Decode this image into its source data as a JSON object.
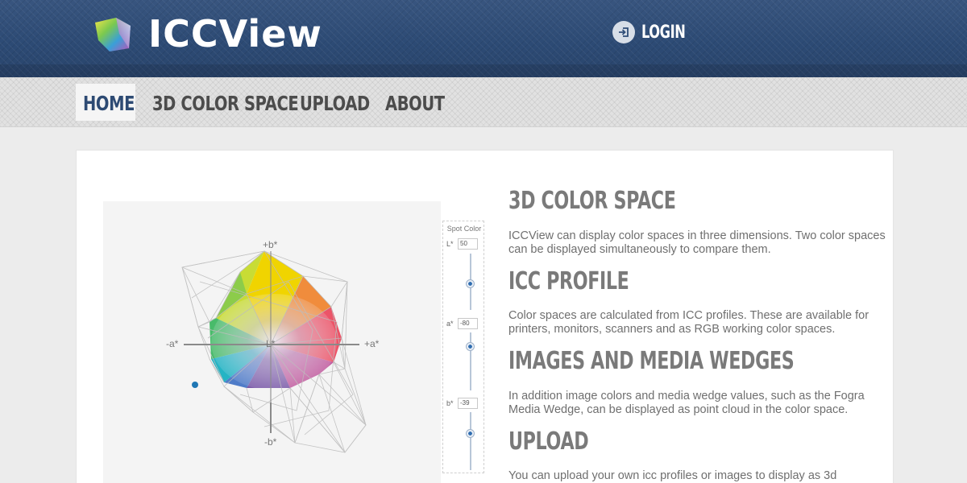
{
  "header": {
    "app_name": "ICCView",
    "login_label": "LOGIN"
  },
  "nav": {
    "items": [
      {
        "label": "HOME",
        "active": true
      },
      {
        "label": "3D COLOR SPACE",
        "active": false
      },
      {
        "label": "UPLOAD",
        "active": false
      },
      {
        "label": "ABOUT",
        "active": false
      }
    ]
  },
  "viewer": {
    "axis_labels": {
      "plus_b": "+b*",
      "minus_b": "-b*",
      "minus_a": "-a*",
      "plus_a": "+a*",
      "l": "L*"
    }
  },
  "spot_color": {
    "title": "Spot Color",
    "fields": [
      {
        "label": "L*",
        "value": "50"
      },
      {
        "label": "a*",
        "value": "-80"
      },
      {
        "label": "b*",
        "value": "-39"
      }
    ]
  },
  "sections": [
    {
      "title": "3D COLOR SPACE",
      "text": "ICCView can display color spaces in three dimensions. Two color spaces can be displayed simultaneously to compare them."
    },
    {
      "title": "ICC PROFILE",
      "text": "Color spaces are calculated from ICC profiles. These are available for printers, monitors, scanners and as RGB working color spaces."
    },
    {
      "title": "IMAGES AND MEDIA WEDGES",
      "text": "In addition image colors and media wedge values, such as the Fogra Media Wedge, can be displayed as point cloud in the color space."
    },
    {
      "title": "UPLOAD",
      "text": "You can upload your own icc profiles or images to display as 3d"
    }
  ],
  "colors": {
    "header_bg": "#2f4d78",
    "nav_active": "#2d4a73",
    "heading": "#7a7a7a",
    "spot_marker": "#1f77b4"
  }
}
